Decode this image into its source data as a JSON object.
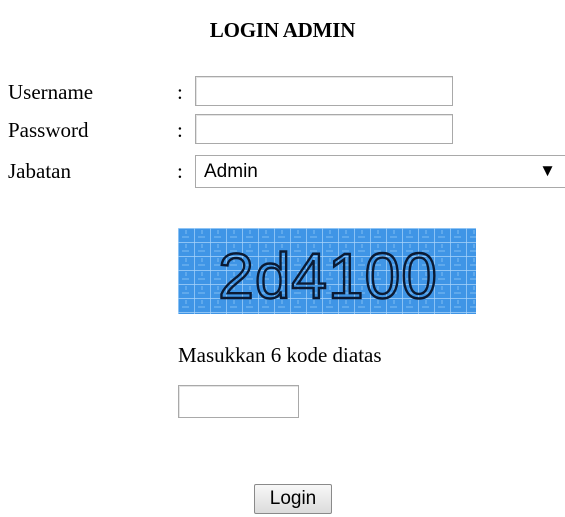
{
  "page_title": "LOGIN ADMIN",
  "form": {
    "username_label": "Username",
    "password_label": "Password",
    "jabatan_label": "Jabatan",
    "separator": ":",
    "username_value": "",
    "password_value": "",
    "jabatan_selected": "Admin",
    "dropdown_arrow": "▼"
  },
  "captcha": {
    "text": "2d4100",
    "icon": "captcha-image",
    "background_color": "#3f95e6",
    "grid_color": "#a9d4fa",
    "text_color": "#0b1a33"
  },
  "captcha_prompt": "Masukkan 6 kode diatas",
  "captcha_input_value": "",
  "login_button_label": "Login"
}
